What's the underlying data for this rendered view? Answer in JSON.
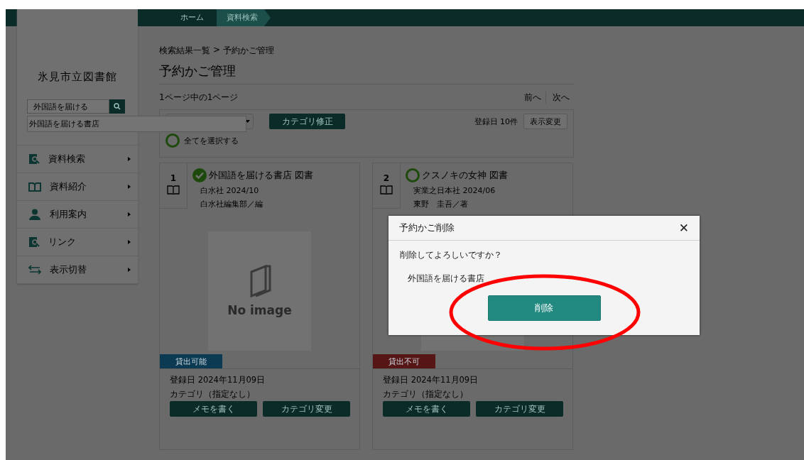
{
  "header_breadcrumb": [
    {
      "label": "ホーム",
      "selected": false
    },
    {
      "label": "資料検索",
      "selected": true
    }
  ],
  "sidebar": {
    "library_name": "氷見市立図書館",
    "search": {
      "value": "外国語を届ける"
    },
    "suggestions": [
      "外国語を届ける書店"
    ],
    "items": [
      {
        "label": "資料検索",
        "kind": "search"
      },
      {
        "label": "資料紹介",
        "kind": "book"
      },
      {
        "label": "利用案内",
        "kind": "guide"
      },
      {
        "label": "リンク",
        "kind": "search"
      },
      {
        "label": "表示切替",
        "kind": "switch"
      }
    ]
  },
  "main": {
    "breadcrumb": [
      "検索結果一覧",
      ">",
      "予約かご管理"
    ],
    "title": "予約かご管理",
    "page_info": "1ページ中の1ページ",
    "pager": [
      "前へ",
      "次へ"
    ],
    "toolbar": {
      "category_button": "カテゴリ修正",
      "sort_info": "登録日 10件",
      "view_button": "表示変更",
      "select_all": {
        "label": "全てを選択する",
        "checked": false
      }
    },
    "books": [
      {
        "number": "1",
        "title": "外国語を届ける書店 図書",
        "selected": true,
        "publisher": "白水社 2024/10",
        "author": "白水社編集部／編",
        "cover_text": "No image",
        "status": {
          "label": "貸出可能",
          "kind": "available"
        },
        "registered": "登録日 2024年11月09日",
        "category": "カテゴリ（指定なし）",
        "buttons": [
          "メモを書く",
          "カテゴリ変更"
        ]
      },
      {
        "number": "2",
        "title": "クスノキの女神 図書",
        "selected": false,
        "publisher": "実業之日本社 2024/06",
        "author": "東野　圭吾／著",
        "status": {
          "label": "貸出不可",
          "kind": "unavailable"
        },
        "registered": "登録日 2024年11月09日",
        "category": "カテゴリ（指定なし）",
        "buttons": [
          "メモを書く",
          "カテゴリ変更"
        ]
      }
    ]
  },
  "dialog": {
    "title": "予約かご削除",
    "close": "✕",
    "message": "削除してよろしいですか？",
    "item": "外国語を届ける書店",
    "confirm_button": "削除",
    "highlighted": true
  }
}
